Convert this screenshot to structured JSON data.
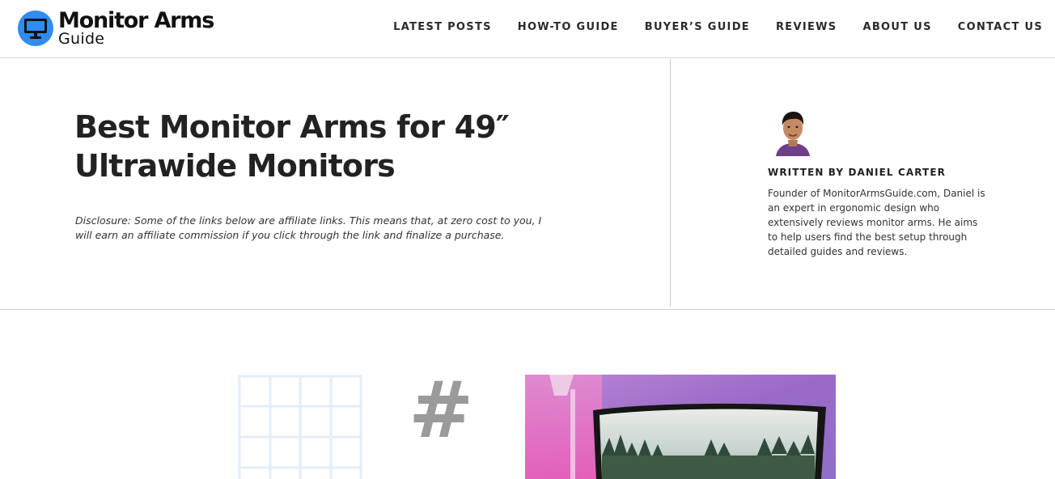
{
  "site": {
    "logo_title": "Monitor Arms",
    "logo_subtitle": "Guide",
    "brand_color": "#2f8cf0"
  },
  "nav": {
    "items": [
      {
        "label": "LATEST POSTS"
      },
      {
        "label": "HOW-TO GUIDE"
      },
      {
        "label": "BUYER’S GUIDE"
      },
      {
        "label": "REVIEWS"
      },
      {
        "label": "ABOUT US"
      },
      {
        "label": "CONTACT US"
      }
    ]
  },
  "article": {
    "title": "Best Monitor Arms for 49″ Ultrawide Monitors",
    "disclosure": "Disclosure: Some of the links below are affiliate links. This means that, at zero cost to you, I will earn an affiliate commission if you click through the link and finalize a purchase."
  },
  "author": {
    "label": "WRITTEN BY DANIEL CARTER",
    "bio": "Founder of MonitorArmsGuide.com, Daniel is an expert in ergonomic design who extensively reviews monitor arms. He aims to help users find the best setup through detailed guides and reviews."
  },
  "featured": {
    "hash_symbol": "#"
  }
}
